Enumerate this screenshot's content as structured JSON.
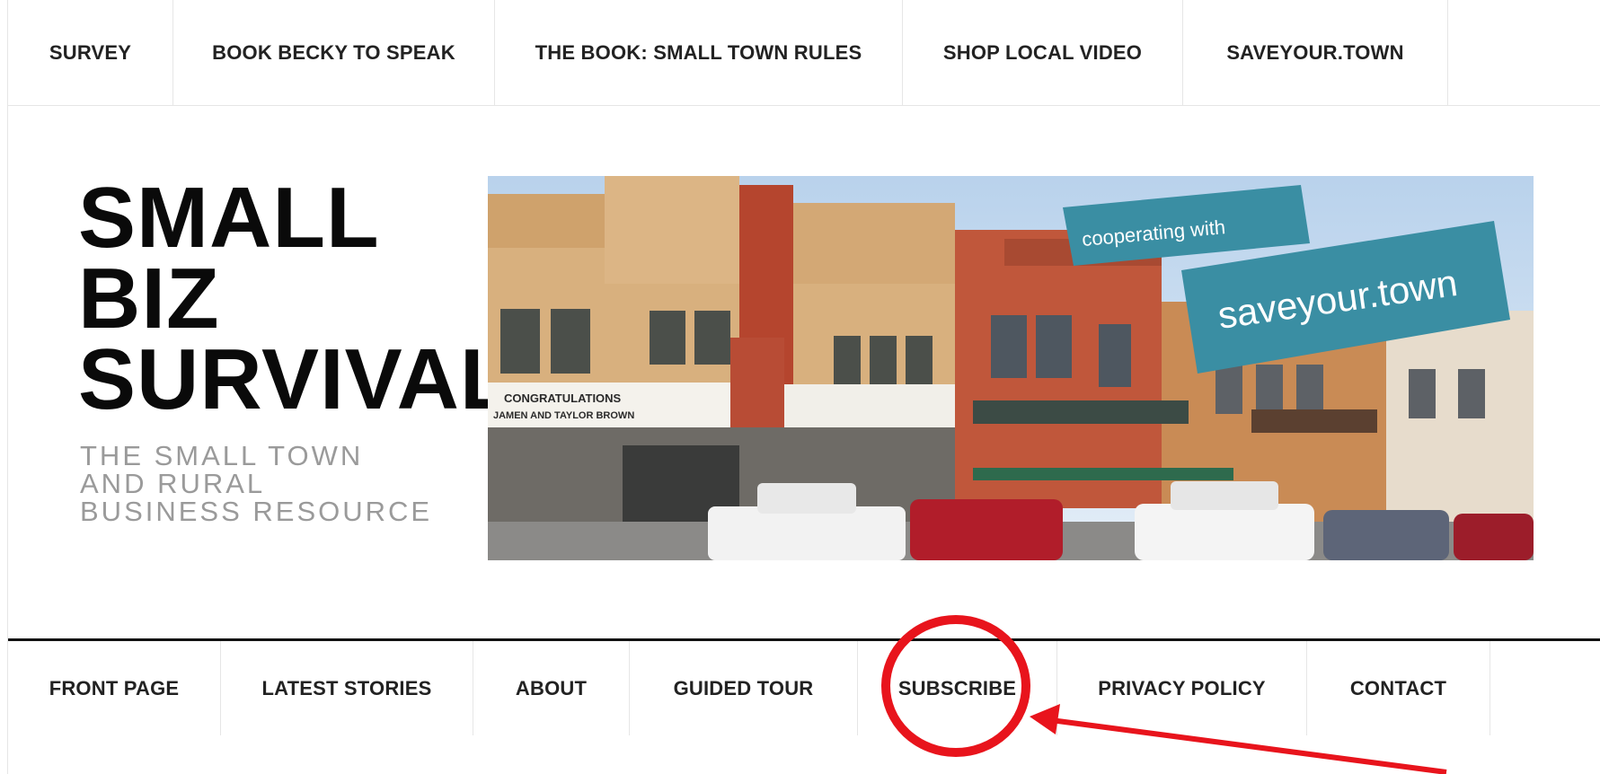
{
  "top_nav": {
    "items": [
      {
        "label": "SURVEY"
      },
      {
        "label": "BOOK BECKY TO SPEAK"
      },
      {
        "label": "THE BOOK: SMALL TOWN RULES"
      },
      {
        "label": "SHOP LOCAL VIDEO"
      },
      {
        "label": "SAVEYOUR.TOWN"
      }
    ]
  },
  "header": {
    "title_lines": [
      "SMALL",
      "BIZ",
      "SURVIVAL"
    ],
    "tagline_lines": [
      "THE SMALL TOWN",
      "AND RURAL",
      "BUSINESS RESOURCE"
    ]
  },
  "banner": {
    "ribbon_small_text": "cooperating with",
    "ribbon_large_text": "saveyour.town",
    "marquee_line1": "CONGRATULATIONS",
    "marquee_line2": "JAMEN AND TAYLOR BROWN",
    "colors": {
      "ribbon": "#3a8ea3",
      "sky": "#c9dbee",
      "brick_light": "#d9b07a",
      "brick_red": "#c0573b"
    }
  },
  "primary_nav": {
    "items": [
      {
        "label": "FRONT PAGE"
      },
      {
        "label": "LATEST STORIES"
      },
      {
        "label": "ABOUT"
      },
      {
        "label": "GUIDED TOUR"
      },
      {
        "label": "SUBSCRIBE"
      },
      {
        "label": "PRIVACY POLICY"
      },
      {
        "label": "CONTACT"
      }
    ]
  },
  "annotation": {
    "color": "#e8141c",
    "target": "SUBSCRIBE"
  }
}
